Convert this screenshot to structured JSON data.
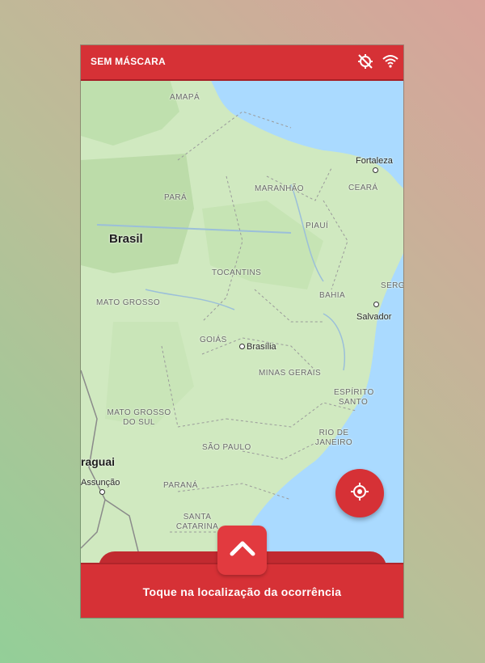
{
  "status_bar": {
    "title": "SEM MÁSCARA",
    "icons": [
      "location-off-icon",
      "wifi-icon"
    ]
  },
  "map": {
    "country_labels": [
      "Brasil",
      "raguai"
    ],
    "state_labels": [
      "AMAPÁ",
      "PARÁ",
      "MARANHÃO",
      "CEARÁ",
      "PIAUÍ",
      "TOCANTINS",
      "MATO GROSSO",
      "BAHIA",
      "SERG",
      "GOIÁS",
      "MINAS GERAIS",
      "ESPÍRITO SANTO",
      "MATO GROSSO DO SUL",
      "RIO DE JANEIRO",
      "SÃO PAULO",
      "PARANÁ",
      "SANTA CATARINA"
    ],
    "cities": [
      "Fortaleza",
      "Salvador",
      "Brasília",
      "Assunção"
    ]
  },
  "locate_button": {
    "icon": "crosshair-icon"
  },
  "expand_button": {
    "icon": "chevron-up-icon"
  },
  "bottom_bar": {
    "label": "Toque na localização da ocorrência"
  },
  "colors": {
    "primary": "#d63136",
    "land": "#d0e9c0",
    "water": "#aadaff"
  }
}
